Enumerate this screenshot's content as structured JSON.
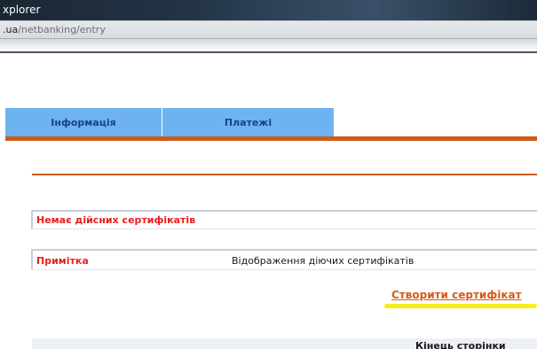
{
  "window": {
    "title": "xplorer",
    "address_domain": ".ua",
    "address_path": "/netbanking/entry"
  },
  "tabs": [
    {
      "label": "Інформація"
    },
    {
      "label": "Платежі"
    }
  ],
  "certificates": {
    "no_certs_message": "Немає дійсних сертифікатів",
    "note_label": "Примітка",
    "note_value": "Відображення діючих сертифікатів",
    "create_link": "Створити сертифікат"
  },
  "footer": {
    "text": "Кінець сторінки"
  },
  "colors": {
    "tab_background": "#6db3f2",
    "tab_text": "#1b3e8f",
    "accent_orange": "#cf5a1c",
    "alert_red": "#e8201e",
    "highlight_yellow": "#f7ef1c"
  }
}
